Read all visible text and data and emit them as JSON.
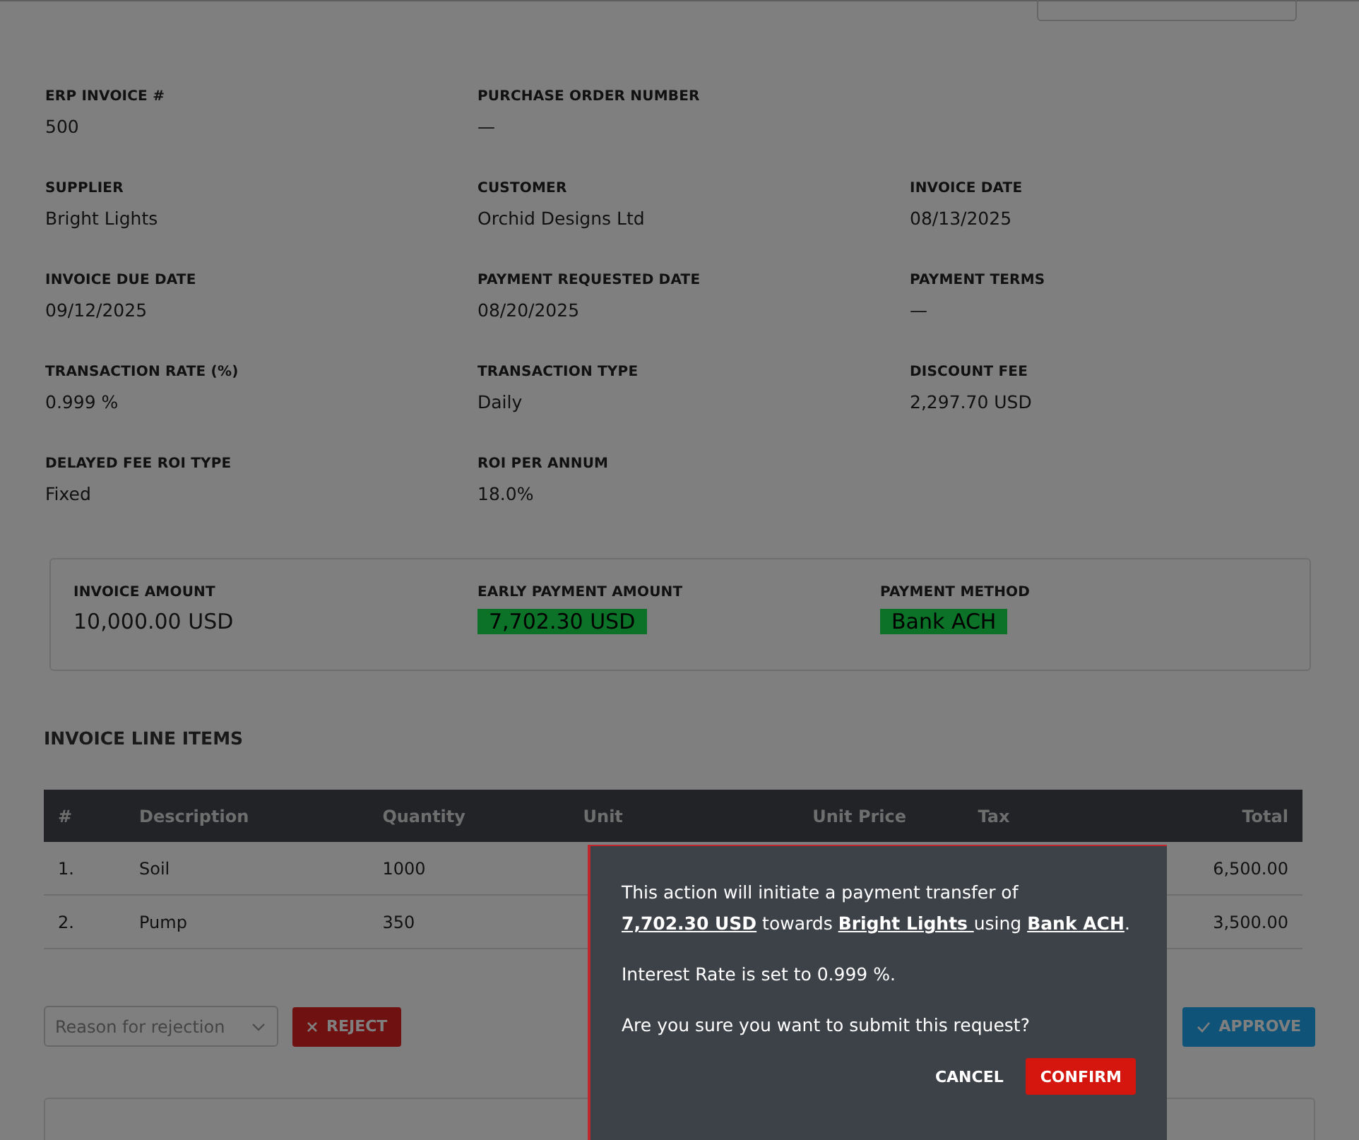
{
  "field_rows": [
    [
      {
        "label": "ERP INVOICE #",
        "value": "500"
      },
      {
        "label": "PURCHASE ORDER NUMBER",
        "value": "—"
      }
    ],
    [
      {
        "label": "SUPPLIER",
        "value": "Bright Lights"
      },
      {
        "label": "CUSTOMER",
        "value": "Orchid Designs Ltd"
      },
      {
        "label": "INVOICE DATE",
        "value": "08/13/2025"
      }
    ],
    [
      {
        "label": "INVOICE DUE DATE",
        "value": "09/12/2025"
      },
      {
        "label": "PAYMENT REQUESTED DATE",
        "value": "08/20/2025"
      },
      {
        "label": "PAYMENT TERMS",
        "value": "—"
      }
    ],
    [
      {
        "label": "TRANSACTION RATE (%)",
        "value": "0.999 %"
      },
      {
        "label": "TRANSACTION TYPE",
        "value": "Daily"
      },
      {
        "label": "DISCOUNT FEE",
        "value": "2,297.70 USD"
      }
    ],
    [
      {
        "label": "DELAYED FEE ROI TYPE",
        "value": "Fixed"
      },
      {
        "label": "ROI PER ANNUM",
        "value": "18.0%"
      }
    ]
  ],
  "summary": [
    {
      "label": "INVOICE AMOUNT",
      "value": "10,000.00 USD",
      "highlighted": false
    },
    {
      "label": "EARLY PAYMENT AMOUNT",
      "value": "7,702.30 USD",
      "highlighted": true
    },
    {
      "label": "PAYMENT METHOD",
      "value": "Bank ACH",
      "highlighted": true
    }
  ],
  "line_items": {
    "title": "INVOICE LINE ITEMS",
    "columns": [
      "#",
      "Description",
      "Quantity",
      "Unit",
      "Unit Price",
      "Tax",
      "Total"
    ],
    "rows": [
      [
        "1.",
        "Soil",
        "1000",
        "6,500.00"
      ],
      [
        "2.",
        "Pump",
        "350",
        "3,500.00"
      ]
    ]
  },
  "rejection_reason": {
    "placeholder": "Reason for rejection"
  },
  "reject_button": "REJECT",
  "approve_button": "APPROVE",
  "dialog": {
    "paragraphs": [
      [
        {
          "kind": "text",
          "text": "This action will initiate a payment transfer of "
        },
        {
          "kind": "link",
          "text": "7,702.30 USD"
        },
        {
          "kind": "text",
          "text": " towards "
        },
        {
          "kind": "link",
          "text": "Bright Lights "
        },
        {
          "kind": "text",
          "text": "using "
        },
        {
          "kind": "link",
          "text": "Bank ACH"
        },
        {
          "kind": "text",
          "text": "."
        }
      ],
      [
        {
          "kind": "text",
          "text": "Interest Rate is set to 0.999 %."
        }
      ],
      [
        {
          "kind": "text",
          "text": "Are you sure you want to submit this request?"
        }
      ]
    ],
    "cancel": "CANCEL",
    "confirm": "CONFIRM"
  }
}
